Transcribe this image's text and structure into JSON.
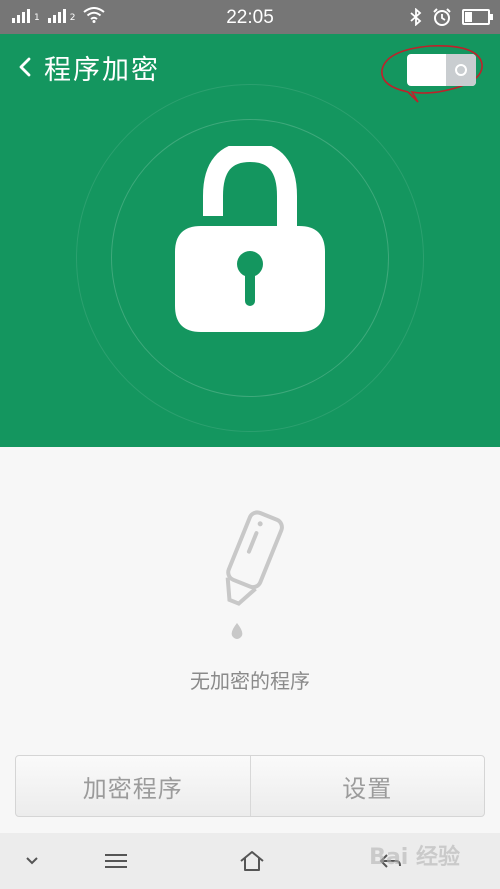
{
  "status_bar": {
    "time": "22:05",
    "sim1_tag": "1",
    "sim2_tag": "2"
  },
  "header": {
    "title": "程序加密",
    "back_icon": "chevron-left-icon",
    "toggle_state": "off"
  },
  "hero": {
    "icon": "padlock-open-icon"
  },
  "empty_state": {
    "icon": "bottle-drop-icon",
    "message": "无加密的程序"
  },
  "actions": {
    "encrypt_label": "加密程序",
    "settings_label": "设置"
  },
  "nav": {
    "items": [
      "chevron-down-icon",
      "menu-icon",
      "home-icon",
      "back-icon"
    ]
  },
  "watermark": "Bai 经验",
  "colors": {
    "primary": "#14965f",
    "status_bar": "#767676",
    "annotation": "#c0202a"
  }
}
